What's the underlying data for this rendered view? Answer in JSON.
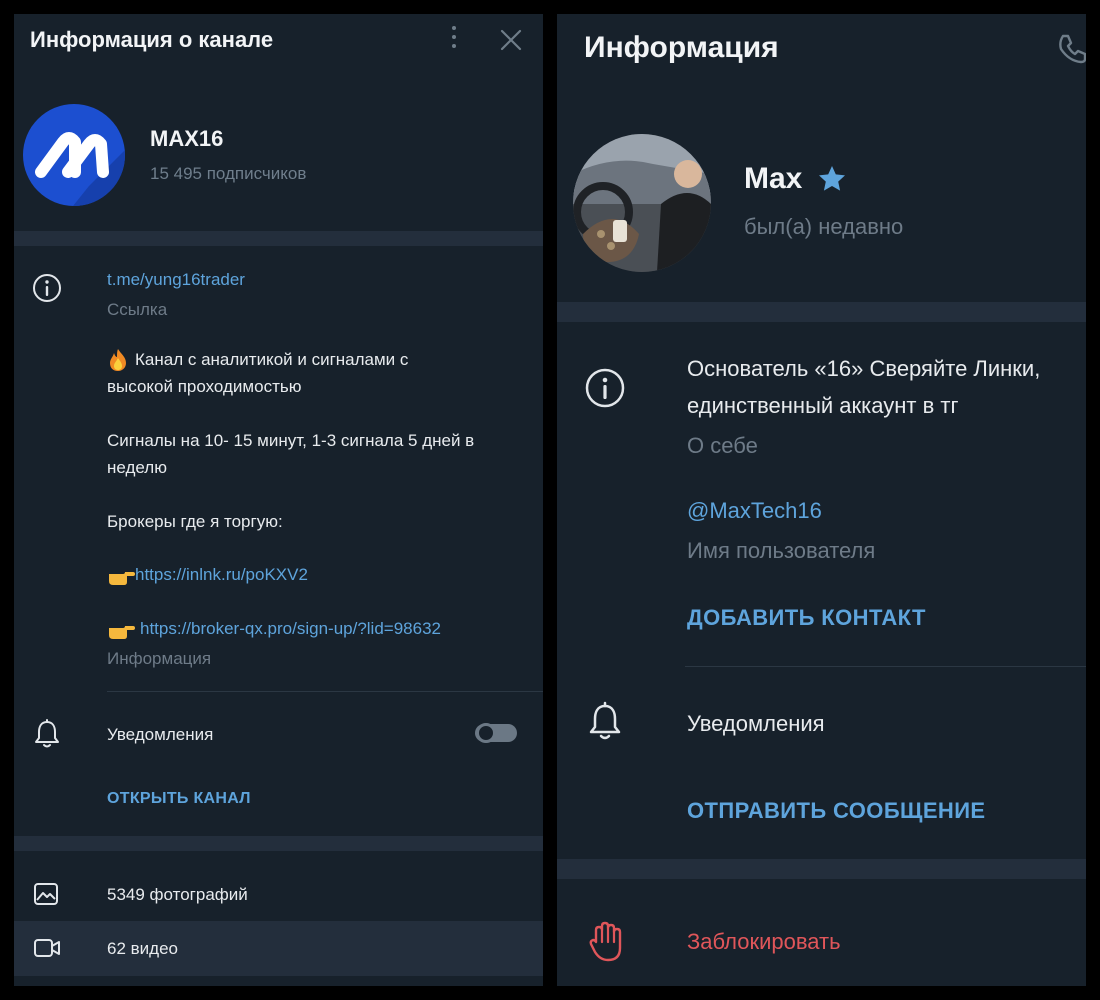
{
  "left": {
    "title": "Информация о канале",
    "channel": {
      "name": "MAX16",
      "subscribers": "15 495 подписчиков"
    },
    "info": {
      "link": "t.me/yung16trader",
      "link_caption": "Ссылка",
      "desc_line1": "Канал с аналитикой и сигналами с",
      "desc_line2": "высокой проходимостью",
      "signals_line1": "Сигналы на 10- 15 минут, 1-3 сигнала 5 дней в",
      "signals_line2": "неделю",
      "brokers": "Брокеры где я торгую:",
      "broker_url1": "https://inlnk.ru/poKXV2",
      "broker_url2": "https://broker-qx.pro/sign-up/?lid=98632",
      "info_caption": "Информация"
    },
    "notifications_label": "Уведомления",
    "notifications_on": false,
    "open_channel": "ОТКРЫТЬ КАНАЛ",
    "media": {
      "photos": "5349 фотографий",
      "videos": "62 видео"
    }
  },
  "right": {
    "title": "Информация",
    "user": {
      "name": "Max",
      "status": "был(а) недавно"
    },
    "about_line1": "Основатель «16» Сверяйте Линки,",
    "about_line2": "единственный аккаунт в тг",
    "about_caption": "О себе",
    "username": "@MaxTech16",
    "username_caption": "Имя пользователя",
    "add_contact": "ДОБАВИТЬ КОНТАКТ",
    "notifications_label": "Уведомления",
    "send_message": "ОТПРАВИТЬ СООБЩЕНИЕ",
    "block": "Заблокировать"
  },
  "colors": {
    "panel_bg": "#17212b",
    "separator": "#232e3c",
    "accent": "#5ea4dc",
    "danger": "#e0565a",
    "muted": "#6e7b88"
  },
  "icons": [
    "more-vertical-icon",
    "close-icon",
    "info-icon",
    "bell-icon",
    "photo-icon",
    "video-icon",
    "phone-icon",
    "star-icon",
    "block-hand-icon",
    "fire-icon",
    "pointing-hand-icon"
  ]
}
